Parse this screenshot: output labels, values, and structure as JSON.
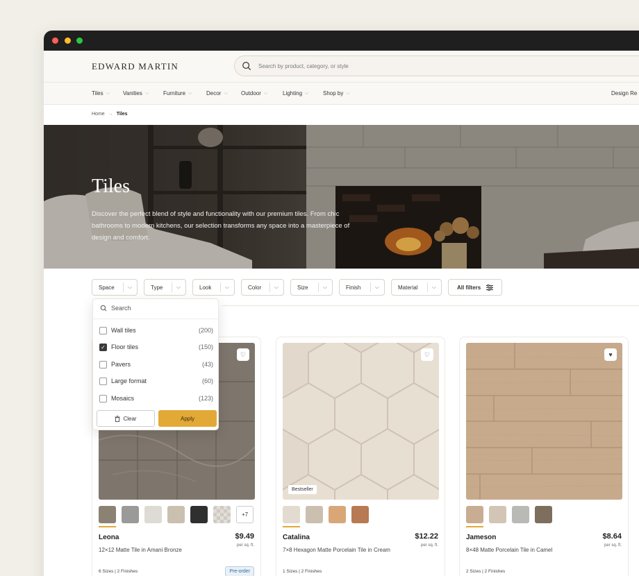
{
  "brand": {
    "name": "EDWARD MARTIN"
  },
  "search": {
    "placeholder": "Search by product, category, or style"
  },
  "nav": {
    "items": [
      {
        "label": "Tiles"
      },
      {
        "label": "Vanities"
      },
      {
        "label": "Furniture"
      },
      {
        "label": "Decor"
      },
      {
        "label": "Outdoor"
      },
      {
        "label": "Lighting"
      },
      {
        "label": "Shop by"
      }
    ],
    "right_link": "Design Re"
  },
  "breadcrumb": {
    "home": "Home",
    "separator": "→",
    "current": "Tiles"
  },
  "hero": {
    "title": "Tiles",
    "description": "Discover the perfect blend of style and functionality with our premium tiles. From chic bathrooms to modern kitchens, our selection transforms any space into a masterpiece of design and comfort."
  },
  "filters": {
    "items": [
      {
        "label": "Space"
      },
      {
        "label": "Type"
      },
      {
        "label": "Look"
      },
      {
        "label": "Color"
      },
      {
        "label": "Size"
      },
      {
        "label": "Finish"
      },
      {
        "label": "Material"
      }
    ],
    "all_label": "All filters"
  },
  "space_dropdown": {
    "search_placeholder": "Search",
    "options": [
      {
        "label": "Wall tiles",
        "count": "(200)",
        "checked": false
      },
      {
        "label": "Floor tiles",
        "count": "(150)",
        "checked": true
      },
      {
        "label": "Pavers",
        "count": "(43)",
        "checked": false
      },
      {
        "label": "Large format",
        "count": "(60)",
        "checked": false
      },
      {
        "label": "Mosaics",
        "count": "(123)",
        "checked": false
      }
    ],
    "clear_label": "Clear",
    "apply_label": "Apply",
    "apply_color": "#e3a937"
  },
  "products": [
    {
      "name": "Leona",
      "description": "12×12 Matte Tile in Amani Bronze",
      "price": "$9.49",
      "unit": "per sq. ft.",
      "meta": "6 Sizes | 2 Finishes",
      "badge": "Pre-order",
      "swatches": [
        "#8b8273",
        "#9a9a98",
        "#dedbd4",
        "#c9c0b0",
        "#2f2f2f",
        "#d8d4ce"
      ],
      "more_swatches": "+7",
      "favorited": false
    },
    {
      "name": "Catalina",
      "description": "7×8 Hexagon Matte Porcelain Tile in Cream",
      "price": "$12.22",
      "unit": "per sq. ft.",
      "meta": "1 Sizes | 2 Finishes",
      "image_badge": "Bestseller",
      "swatches": [
        "#e3dbd0",
        "#cbbfb0",
        "#d9a777",
        "#b77a52"
      ],
      "favorited": false
    },
    {
      "name": "Jameson",
      "description": "8×48 Matte Porcelain Tile in Camel",
      "price": "$8.64",
      "unit": "per sq. ft.",
      "meta": "2 Sizes | 2 Finishes",
      "swatches": [
        "#c9ad92",
        "#d3c5b5",
        "#b9bab5",
        "#7e6e5e"
      ],
      "favorited": true
    }
  ]
}
